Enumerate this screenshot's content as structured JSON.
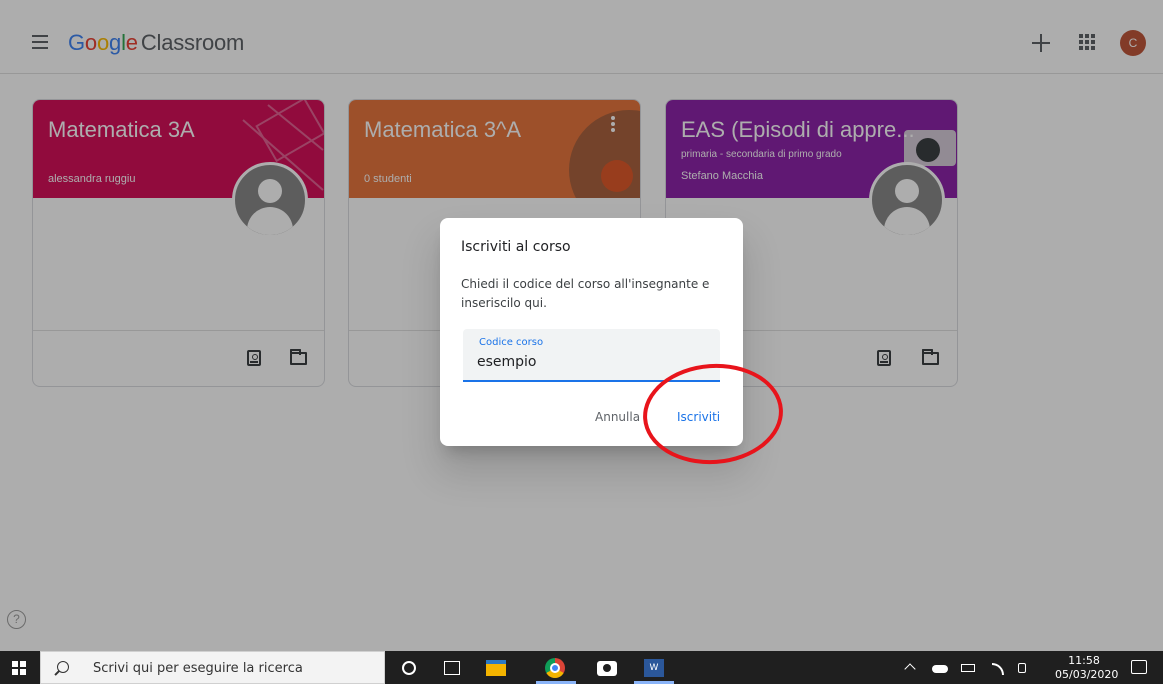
{
  "app": {
    "brand_letters": [
      {
        "ch": "G",
        "color": "#4285f4"
      },
      {
        "ch": "o",
        "color": "#ea4335"
      },
      {
        "ch": "o",
        "color": "#fbbc05"
      },
      {
        "ch": "g",
        "color": "#4285f4"
      },
      {
        "ch": "l",
        "color": "#34a853"
      },
      {
        "ch": "e",
        "color": "#ea4335"
      }
    ],
    "product": "Classroom",
    "avatar_initial": "C",
    "avatar_color": "#c0583c"
  },
  "cards": [
    {
      "title": "Matematica 3A",
      "subtitle1": "alessandra ruggiu",
      "subtitle2": "",
      "color": "#d6115b"
    },
    {
      "title": "Matematica 3^A",
      "subtitle1": "0 studenti",
      "subtitle2": "",
      "color": "#e8773f"
    },
    {
      "title": "EAS (Episodi di appre...",
      "subtitle1": "primaria - secondaria di primo grado",
      "subtitle2": "Stefano Macchia",
      "color": "#8e24aa"
    }
  ],
  "dialog": {
    "title": "Iscriviti al corso",
    "text": "Chiedi il codice del corso all'insegnante e inseriscilo qui.",
    "field_label": "Codice corso",
    "field_value": "esempio",
    "cancel_label": "Annulla",
    "join_label": "Iscriviti",
    "accent": "#1a73e8"
  },
  "help": {
    "symbol": "?"
  },
  "annotation": {
    "color": "#e8141b"
  },
  "taskbar": {
    "search_placeholder": "Scrivi qui per eseguire la ricerca",
    "word_label": "W",
    "time": "11:58",
    "date": "05/03/2020"
  }
}
